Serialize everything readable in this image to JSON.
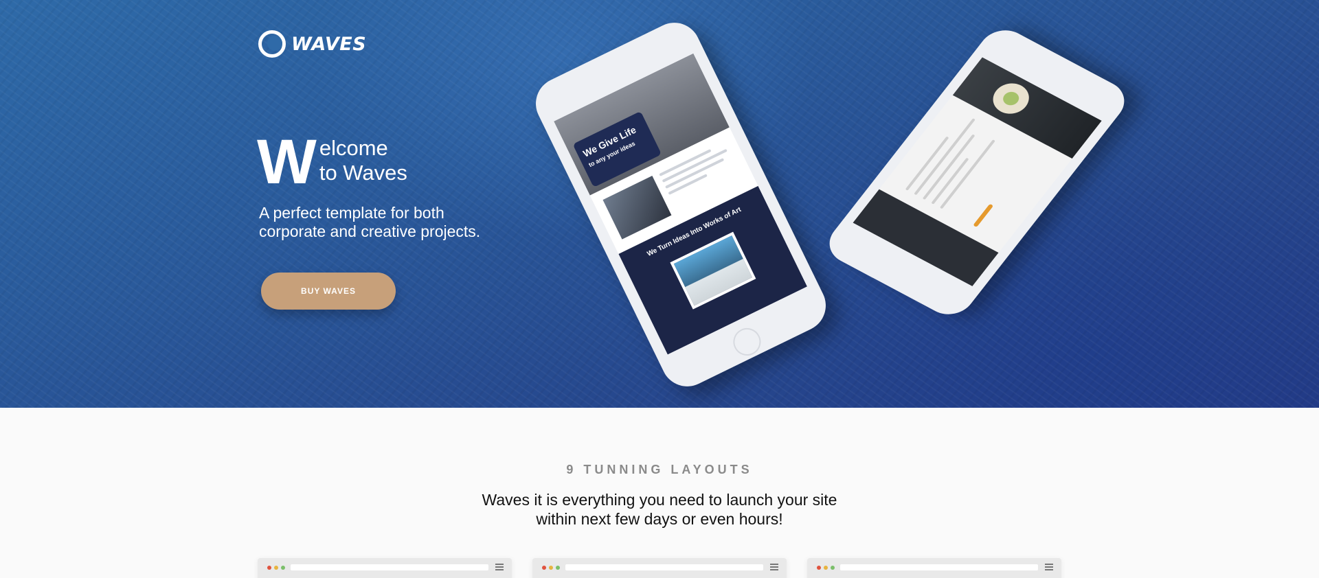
{
  "brand": {
    "logo_text": "WAVES"
  },
  "hero": {
    "big_letter": "W",
    "welcome_line1": "elcome",
    "welcome_line2": "to Waves",
    "subtitle_line1": "A perfect template for both",
    "subtitle_line2": "corporate and creative projects.",
    "cta_label": "BUY WAVES"
  },
  "mockup": {
    "screen_headline": "We Give Life to any your ideas",
    "screen_section_title": "We Turn Ideas Into Works of Art"
  },
  "layouts_section": {
    "label": "9 TUNNING LAYOUTS",
    "title_line1": "Waves it is everything you need to launch your site",
    "title_line2": "within next few days or even hours!"
  },
  "colors": {
    "hero_blue": "#2a5b9c",
    "cta_tan": "#c7a07a",
    "dot_red": "#e0533f",
    "dot_yellow": "#e7b440",
    "dot_green": "#7bbf6a"
  },
  "icons": [
    "logo-mark-icon",
    "browser-dot-icon",
    "menu-icon"
  ]
}
